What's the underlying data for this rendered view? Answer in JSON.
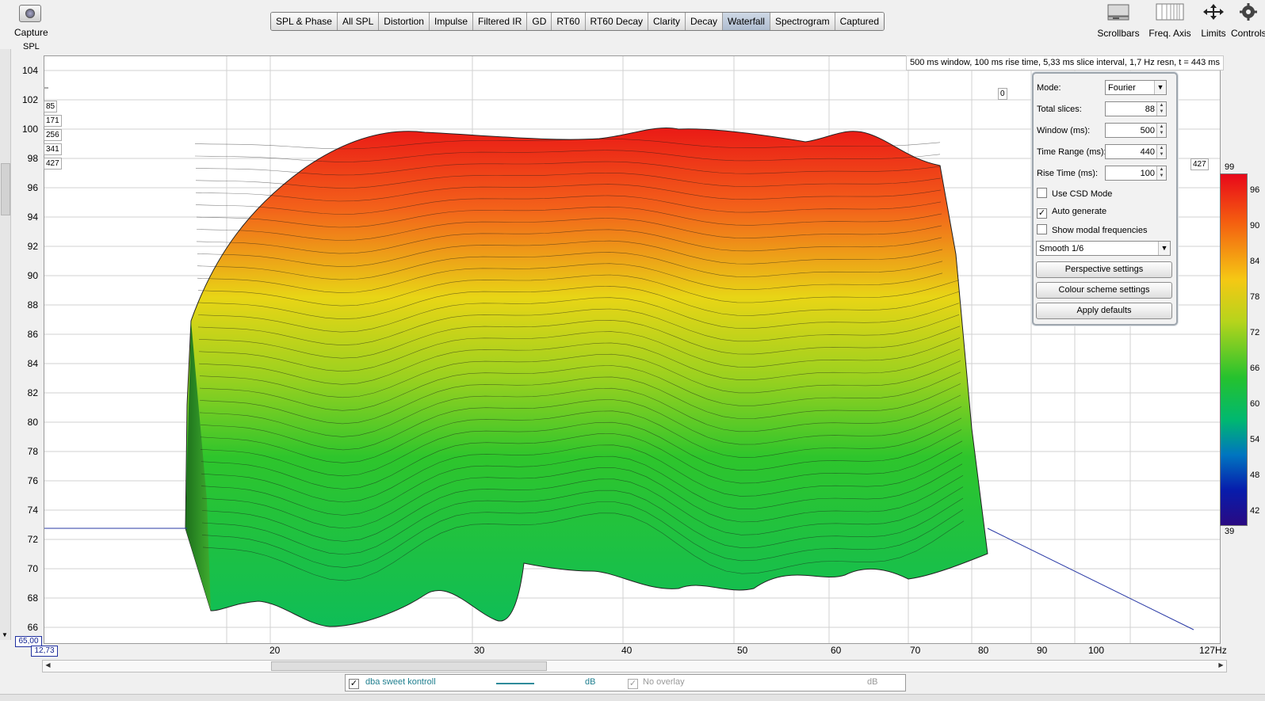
{
  "capture": {
    "label": "Capture"
  },
  "tabs": [
    {
      "label": "SPL & Phase",
      "active": false
    },
    {
      "label": "All SPL",
      "active": false
    },
    {
      "label": "Distortion",
      "active": false
    },
    {
      "label": "Impulse",
      "active": false
    },
    {
      "label": "Filtered IR",
      "active": false
    },
    {
      "label": "GD",
      "active": false
    },
    {
      "label": "RT60",
      "active": false
    },
    {
      "label": "RT60 Decay",
      "active": false
    },
    {
      "label": "Clarity",
      "active": false
    },
    {
      "label": "Decay",
      "active": false
    },
    {
      "label": "Waterfall",
      "active": true
    },
    {
      "label": "Spectrogram",
      "active": false
    },
    {
      "label": "Captured",
      "active": false
    }
  ],
  "tools": {
    "scrollbars": "Scrollbars",
    "freq_axis": "Freq. Axis",
    "limits": "Limits",
    "controls": "Controls"
  },
  "plot": {
    "y_label": "SPL",
    "y_ticks": [
      "104",
      "102",
      "100",
      "98",
      "96",
      "94",
      "92",
      "90",
      "88",
      "86",
      "84",
      "82",
      "80",
      "78",
      "76",
      "74",
      "72",
      "70",
      "68",
      "66"
    ],
    "y_min_box": "65,00",
    "x_min_box": "12,73",
    "x_ticks": [
      "20",
      "30",
      "40",
      "50",
      "60",
      "70",
      "80",
      "90",
      "100",
      "127Hz"
    ],
    "info": "500 ms window, 100 ms rise time, 5,33 ms slice interval, 1,7 Hz resn, t = 443 ms",
    "slice_tags_left": [
      "",
      "85",
      "171",
      "256",
      "341",
      "427"
    ],
    "slice_tag_zero": "0",
    "slice_tag_171": "171",
    "slice_tag_right": "427"
  },
  "panel": {
    "mode_label": "Mode:",
    "mode_value": "Fourier",
    "total_slices_label": "Total slices:",
    "total_slices_value": "88",
    "window_label": "Window (ms):",
    "window_value": "500",
    "time_range_label": "Time Range (ms):",
    "time_range_value": "440",
    "rise_time_label": "Rise Time (ms):",
    "rise_time_value": "100",
    "use_csd_label": "Use CSD Mode",
    "use_csd_checked": false,
    "auto_generate_label": "Auto generate",
    "auto_generate_checked": true,
    "show_modal_label": "Show modal frequencies",
    "show_modal_checked": false,
    "smoothing_value": "Smooth 1/6",
    "perspective_btn": "Perspective settings",
    "colour_btn": "Colour scheme settings",
    "defaults_btn": "Apply defaults"
  },
  "colour_scale": {
    "top": "99",
    "bottom": "39",
    "ticks": [
      "96",
      "90",
      "84",
      "78",
      "72",
      "66",
      "60",
      "54",
      "48",
      "42"
    ]
  },
  "legend": {
    "measurement": "dba sweet kontroll",
    "measurement_checked": true,
    "unit1": "dB",
    "overlay": "No overlay",
    "overlay_checked": true,
    "unit2": "dB",
    "trace_color": "#2e8b9a"
  }
}
